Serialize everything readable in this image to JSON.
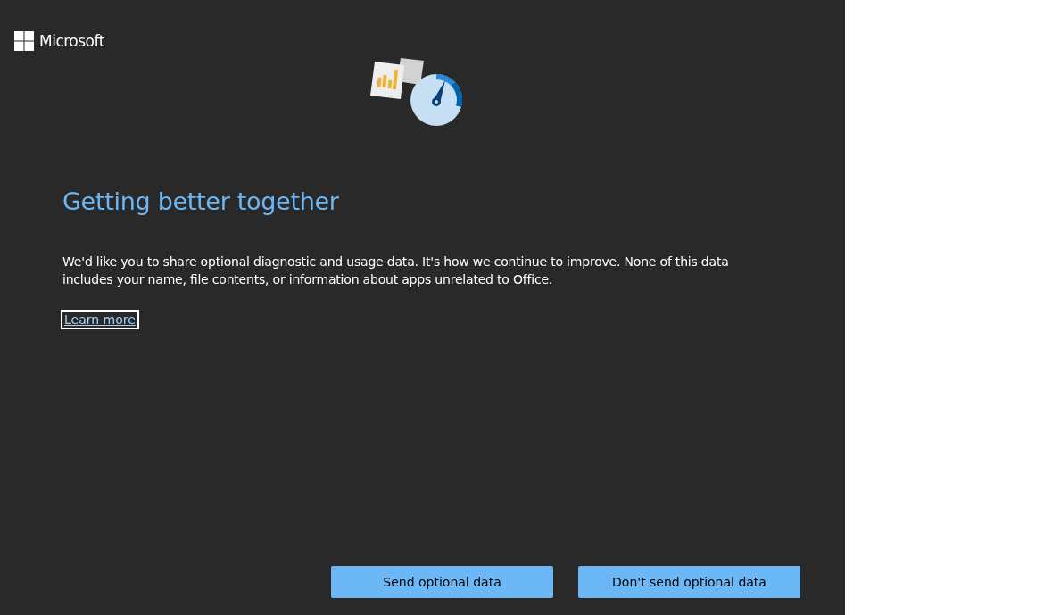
{
  "brand": {
    "name": "Microsoft"
  },
  "title": "Getting better together",
  "description": "We'd like you to share optional diagnostic and usage data. It's how we continue to improve. None of this data includes your name, file contents, or information about apps unrelated to Office.",
  "link": {
    "label": "Learn more",
    "focused": true
  },
  "buttons": [
    {
      "label": "Send optional data"
    },
    {
      "label": "Don't send optional data"
    }
  ]
}
